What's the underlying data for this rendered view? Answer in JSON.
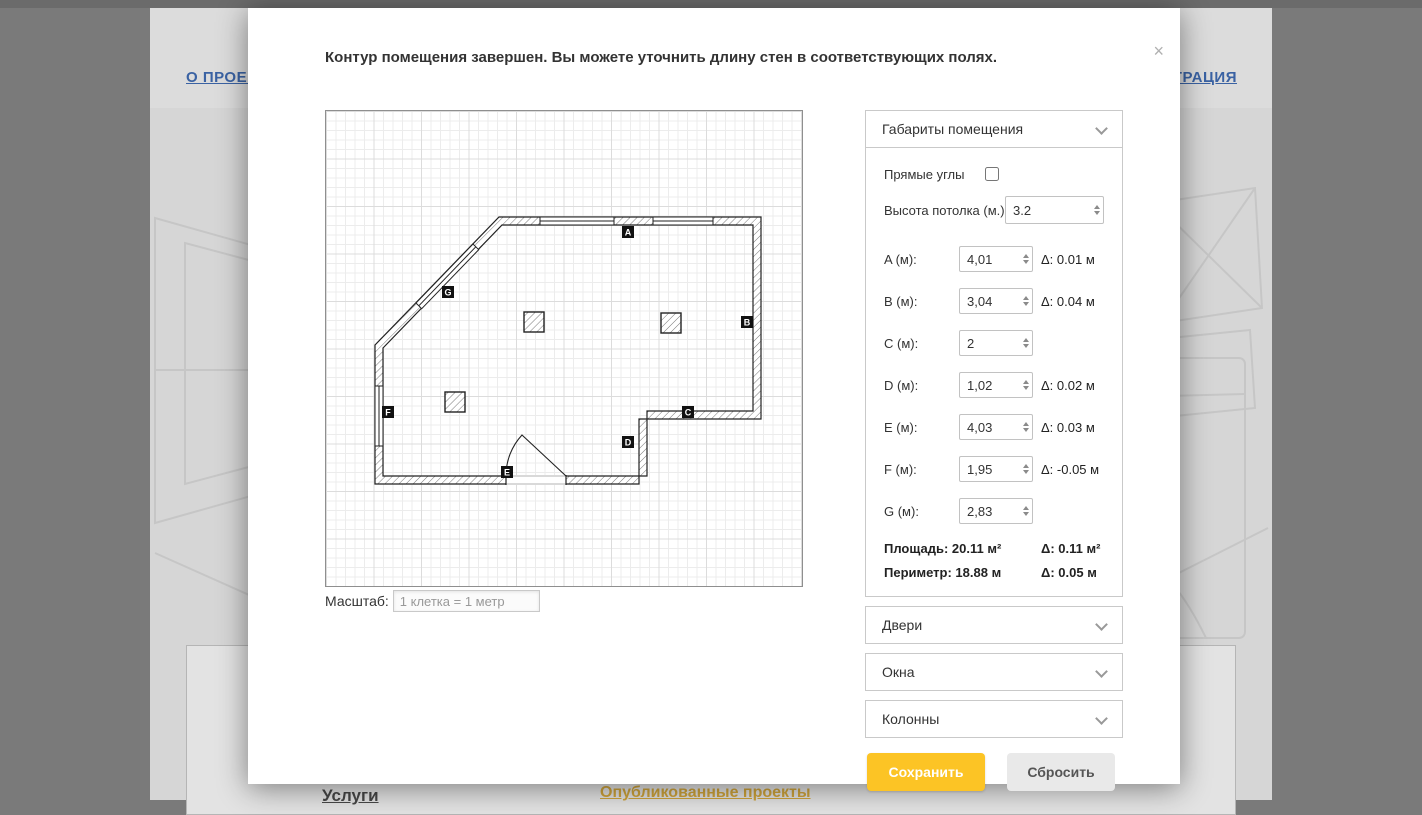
{
  "page": {
    "link_about": "О ПРОЕКТЕ",
    "link_registration": "РЕГИСТРАЦИЯ",
    "section_services": "Услуги",
    "section_published": "Опубликованные проекты"
  },
  "modal": {
    "title": "Контур помещения завершен. Вы можете уточнить длину стен в соответствующих полях.",
    "close_label": "×",
    "scale": {
      "label": "Масштаб:",
      "value": "1 клетка = 1 метр"
    },
    "dimensions": {
      "header": "Габариты помещения",
      "right_angles_label": "Прямые углы",
      "ceiling_label": "Высота потолка (м.)",
      "ceiling_value": "3.2",
      "walls": [
        {
          "label": "A (м):",
          "value": "4,01",
          "delta": "Δ: 0.01 м"
        },
        {
          "label": "B (м):",
          "value": "3,04",
          "delta": "Δ: 0.04 м"
        },
        {
          "label": "C (м):",
          "value": "2",
          "delta": ""
        },
        {
          "label": "D (м):",
          "value": "1,02",
          "delta": "Δ: 0.02 м"
        },
        {
          "label": "E (м):",
          "value": "4,03",
          "delta": "Δ: 0.03 м"
        },
        {
          "label": "F (м):",
          "value": "1,95",
          "delta": "Δ: -0.05 м"
        },
        {
          "label": "G (м):",
          "value": "2,83",
          "delta": ""
        }
      ],
      "area_label": "Площадь: 20.11 м²",
      "area_delta": "Δ: 0.11 м²",
      "perimeter_label": "Периметр: 18.88 м",
      "perimeter_delta": "Δ: 0.05 м"
    },
    "accordions": {
      "doors": "Двери",
      "windows": "Окна",
      "columns": "Колонны"
    },
    "buttons": {
      "save": "Сохранить",
      "reset": "Сбросить"
    }
  },
  "plan": {
    "markers": {
      "a": "A",
      "b": "B",
      "c": "C",
      "d": "D",
      "e": "E",
      "f": "F",
      "g": "G"
    }
  },
  "colors": {
    "accent_yellow": "#fcc425",
    "link_blue": "#3a62a3"
  }
}
